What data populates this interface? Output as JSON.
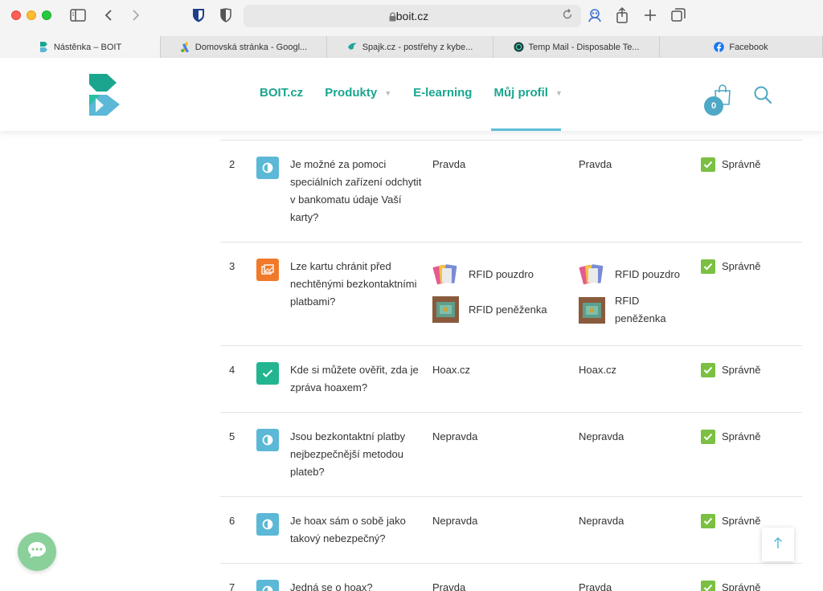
{
  "browser": {
    "url": "boit.cz",
    "tabs": [
      {
        "label": "Nástěnka – BOIT",
        "active": true
      },
      {
        "label": "Domovská stránka - Googl...",
        "active": false
      },
      {
        "label": "Spajk.cz - postřehy z kybe...",
        "active": false
      },
      {
        "label": "Temp Mail - Disposable Te...",
        "active": false
      },
      {
        "label": "Facebook",
        "active": false
      }
    ]
  },
  "header": {
    "nav": [
      {
        "label": "BOIT.cz",
        "has_caret": false
      },
      {
        "label": "Produkty",
        "has_caret": true
      },
      {
        "label": "E-learning",
        "has_caret": false
      },
      {
        "label": "Můj profil",
        "has_caret": true
      }
    ],
    "cart_count": "0"
  },
  "colors": {
    "brand": "#1aa58e",
    "accent_blue": "#5bb8d6",
    "orange": "#f07a2a",
    "green": "#7bc043"
  },
  "results": [
    {
      "num": "2",
      "icon": "true-false-icon",
      "question": "Je možné za pomoci speciálních zařízení odchytit v bankomatu údaje Vaší karty?",
      "answer": "Pravda",
      "correct": "Pravda",
      "result": "Správně"
    },
    {
      "num": "3",
      "icon": "image-choice-icon",
      "question": "Lze kartu chránit před nechtěnými bezkontaktními platbami?",
      "answer_items": [
        "RFID pouzdro",
        "RFID peněženka"
      ],
      "correct_items": [
        "RFID pouzdro",
        "RFID peněženka"
      ],
      "result": "Správně"
    },
    {
      "num": "4",
      "icon": "single-choice-icon",
      "question": "Kde si můžete ověřit, zda je zpráva hoaxem?",
      "answer": "Hoax.cz",
      "correct": "Hoax.cz",
      "result": "Správně"
    },
    {
      "num": "5",
      "icon": "true-false-icon",
      "question": "Jsou bezkontaktní platby nejbezpečnější metodou plateb?",
      "answer": "Nepravda",
      "correct": "Nepravda",
      "result": "Správně"
    },
    {
      "num": "6",
      "icon": "true-false-icon",
      "question": "Je hoax sám o sobě jako takový nebezpečný?",
      "answer": "Nepravda",
      "correct": "Nepravda",
      "result": "Správně"
    },
    {
      "num": "7",
      "icon": "true-false-icon",
      "question": "Jedná se o hoax?",
      "answer": "Pravda",
      "correct": "Pravda",
      "result": "Správně"
    }
  ]
}
